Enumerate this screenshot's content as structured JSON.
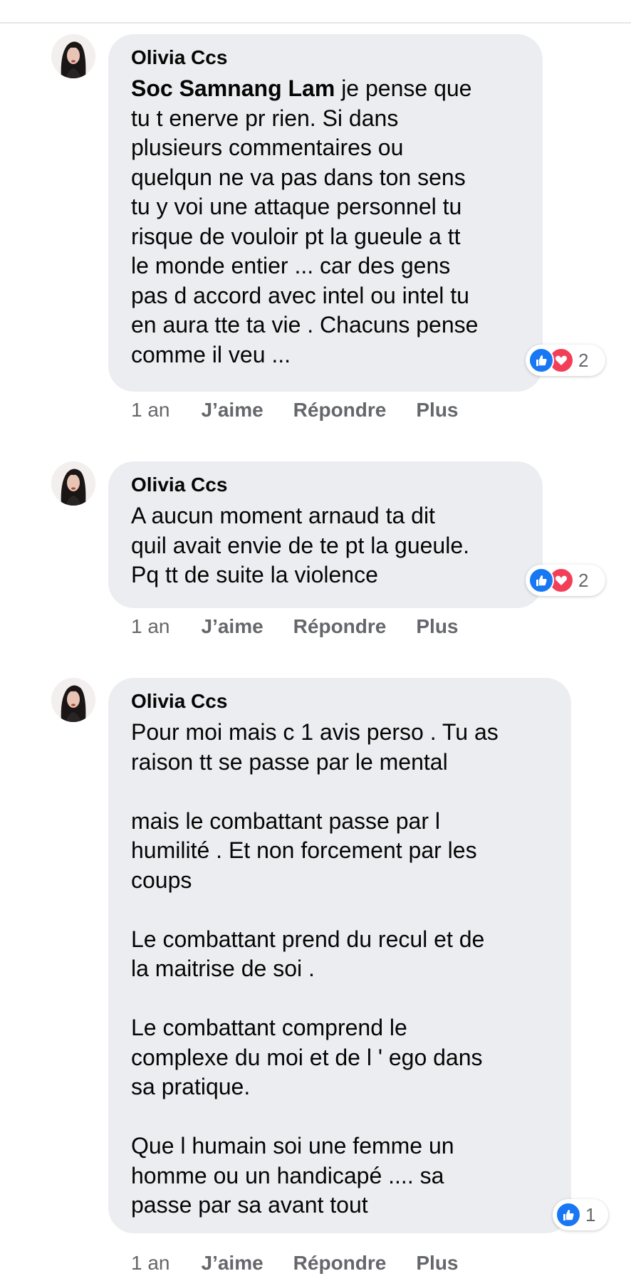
{
  "comments": [
    {
      "author": "Olivia Ccs",
      "mention": "Soc Samnang Lam",
      "text": " je pense que\ntu t enerve pr rien. Si dans\nplusieurs commentaires ou\nquelqun ne va pas dans ton sens\ntu y voi une attaque personnel tu\nrisque de vouloir pt la gueule a tt\nle monde entier ... car des gens\npas d accord avec intel ou intel tu\nen aura tte ta vie . Chacuns pense\ncomme il veu ...",
      "reactions": [
        "like-icon",
        "love-icon"
      ],
      "reaction_count": "2",
      "time": "1 an",
      "like_label": "J’aime",
      "reply_label": "Répondre",
      "more_label": "Plus"
    },
    {
      "author": "Olivia Ccs",
      "mention": "",
      "text": "A aucun moment arnaud ta dit\nquil avait envie de te pt la gueule.\nPq tt de suite la violence",
      "reactions": [
        "like-icon",
        "love-icon"
      ],
      "reaction_count": "2",
      "time": "1 an",
      "like_label": "J’aime",
      "reply_label": "Répondre",
      "more_label": "Plus"
    },
    {
      "author": "Olivia Ccs",
      "mention": "",
      "text": "Pour moi mais c 1 avis perso . Tu as\nraison tt se passe par le mental\n\nmais le combattant passe par l\nhumilité . Et non forcement par les\ncoups\n\nLe combattant prend du recul et de\nla maitrise de soi .\n\nLe combattant comprend le\ncomplexe du moi et de l ' ego dans\nsa pratique.\n\nQue l humain soi une femme un\nhomme ou un handicapé .... sa\npasse par sa avant tout",
      "reactions": [
        "like-icon"
      ],
      "reaction_count": "1",
      "time": "1 an",
      "like_label": "J’aime",
      "reply_label": "Répondre",
      "more_label": "Plus"
    }
  ],
  "colors": {
    "bubble": "#ebedf0",
    "secondary_text": "#65676b",
    "like_blue": "#1877f2",
    "love_red": "#f33e58"
  }
}
